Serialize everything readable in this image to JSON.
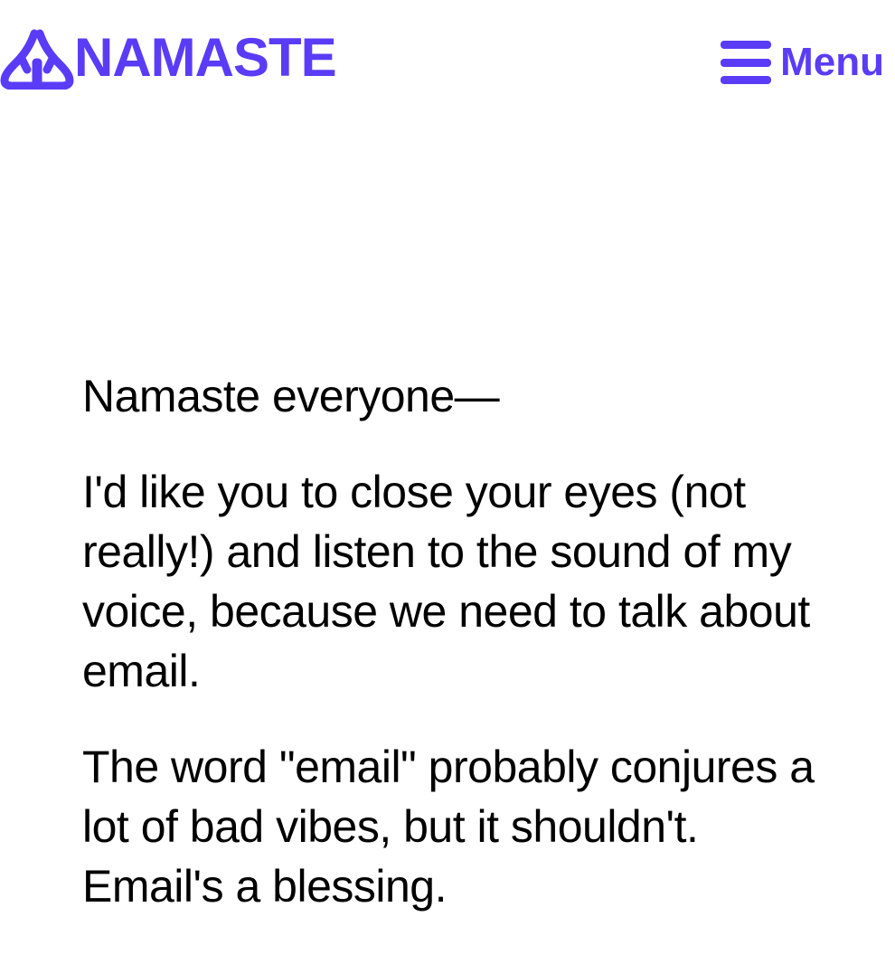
{
  "colors": {
    "brand": "#5b3cf6",
    "text": "#000000",
    "background": "#ffffff"
  },
  "header": {
    "logo": {
      "icon": "praying-hands-icon",
      "text": "NAMASTE"
    },
    "menu": {
      "icon": "hamburger-menu-icon",
      "label": "Menu"
    }
  },
  "content": {
    "paragraphs": [
      "Namaste everyone—",
      "I'd like you to close your eyes (not really!) and listen to the sound of my voice, because we need to talk about email.",
      "The word \"email\" probably conjures a lot of bad vibes, but it shouldn't. Email's a blessing."
    ]
  }
}
